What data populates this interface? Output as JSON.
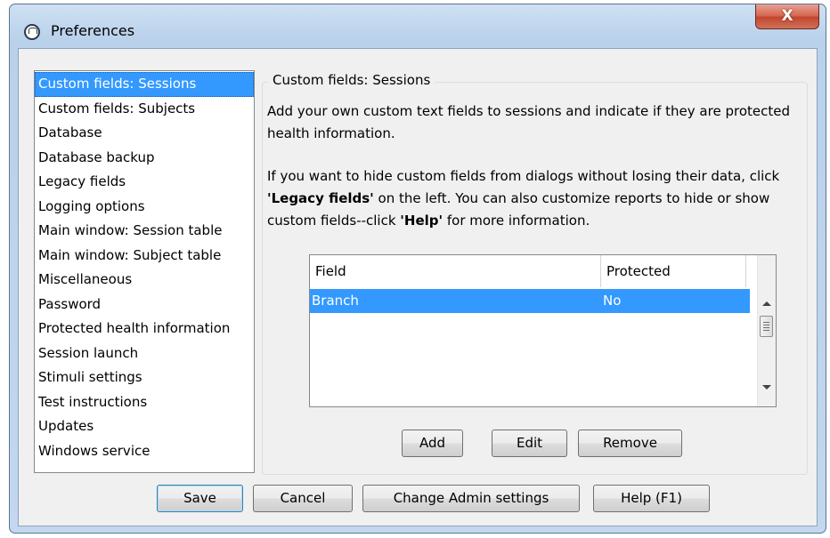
{
  "window": {
    "title": "Preferences",
    "close_label": "X"
  },
  "sidebar": {
    "items": [
      {
        "label": "Custom fields: Sessions",
        "selected": true
      },
      {
        "label": "Custom fields: Subjects"
      },
      {
        "label": "Database"
      },
      {
        "label": "Database backup"
      },
      {
        "label": "Legacy fields"
      },
      {
        "label": "Logging options"
      },
      {
        "label": "Main window: Session table"
      },
      {
        "label": "Main window: Subject table"
      },
      {
        "label": "Miscellaneous"
      },
      {
        "label": "Password"
      },
      {
        "label": "Protected health information"
      },
      {
        "label": "Session launch"
      },
      {
        "label": "Stimuli settings"
      },
      {
        "label": "Test instructions"
      },
      {
        "label": "Updates"
      },
      {
        "label": "Windows service"
      }
    ]
  },
  "panel": {
    "title": "Custom fields: Sessions",
    "para1": "Add your own custom text fields to sessions and indicate if they are protected health information.",
    "para2": {
      "t1": "If you want to hide custom fields from dialogs without losing their data, click ",
      "b1": "'Legacy fields'",
      "t2": " on the left. You can also customize reports to hide or show custom fields--click ",
      "b2": "'Help'",
      "t3": " for more information."
    },
    "table": {
      "columns": [
        "Field",
        "Protected"
      ],
      "rows": [
        {
          "field": "Branch",
          "protected": "No",
          "selected": true
        }
      ]
    },
    "buttons": {
      "add": "Add",
      "edit": "Edit",
      "remove": "Remove"
    }
  },
  "footer": {
    "save": "Save",
    "cancel": "Cancel",
    "change_admin": "Change Admin settings",
    "help": "Help (F1)"
  },
  "colors": {
    "selection": "#3399ff",
    "close_button": "#c7503a"
  }
}
